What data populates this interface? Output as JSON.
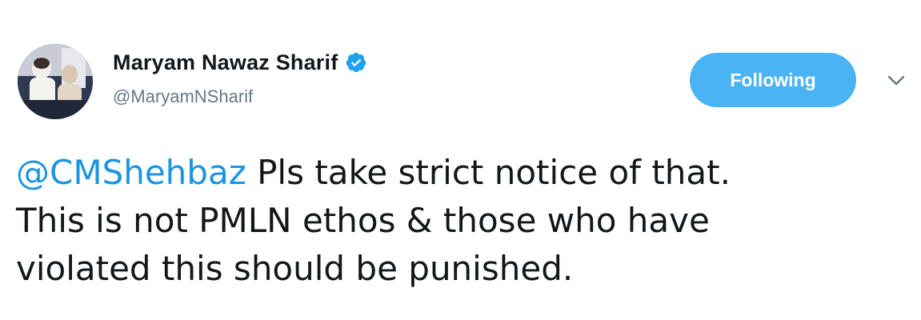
{
  "tweet": {
    "author": {
      "display_name": "Maryam Nawaz Sharif",
      "handle": "@MaryamNSharif",
      "verified": true
    },
    "follow_button_label": "Following",
    "text": {
      "mention": "@CMShehbaz",
      "line1_rest": " Pls take strict notice of that.",
      "line2": "This is not PMLN ethos & those who have",
      "line3": "violated this should be punished."
    }
  },
  "colors": {
    "accent": "#1b95e0",
    "follow_button_bg": "#4ab3f4",
    "handle": "#657786",
    "text": "#14171a"
  },
  "icons": {
    "verified": "verified-badge-icon",
    "caret": "chevron-down-icon"
  }
}
